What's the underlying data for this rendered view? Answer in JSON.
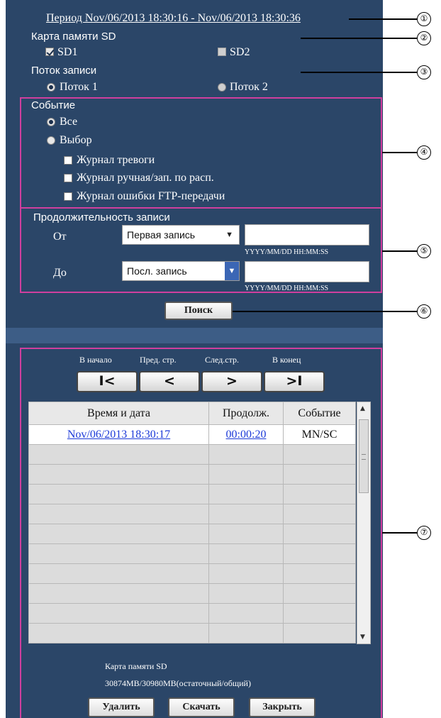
{
  "period": "Период Nov/06/2013 18:30:16 - Nov/06/2013 18:30:36",
  "sd_card": {
    "label": "Карта памяти SD",
    "sd1": "SD1",
    "sd2": "SD2"
  },
  "stream": {
    "label": "Поток записи",
    "stream1": "Поток 1",
    "stream2": "Поток 2"
  },
  "event": {
    "label": "Событие",
    "all": "Все",
    "select": "Выбор",
    "alarm_log": "Журнал тревоги",
    "manual_log": "Журнал ручная/зап. по расп.",
    "ftp_error_log": "Журнал ошибки FTP-передачи"
  },
  "duration": {
    "label": "Продолжительность записи",
    "from_label": "От",
    "to_label": "До",
    "from_value": "Первая запись",
    "to_value": "Посл. запись",
    "format_hint": "YYYY/MM/DD HH:MM:SS"
  },
  "search_button": "Поиск",
  "nav": {
    "first_label": "В начало",
    "prev_label": "Пред. стр.",
    "next_label": "След.стр.",
    "last_label": "В конец",
    "first_glyph": "I<",
    "prev_glyph": "<",
    "next_glyph": ">",
    "last_glyph": ">I"
  },
  "table": {
    "headers": [
      "Время и дата",
      "Продолж.",
      "Событие"
    ],
    "rows": [
      {
        "datetime": "Nov/06/2013  18:30:17",
        "duration": "00:00:20",
        "event": "MN/SC"
      }
    ]
  },
  "footer": {
    "sd_label": "Карта памяти SD",
    "capacity": "30874MB/30980MB(остаточный/общий)",
    "delete": "Удалить",
    "download": "Скачать",
    "close": "Закрыть"
  },
  "callouts": [
    "①",
    "②",
    "③",
    "④",
    "⑤",
    "⑥",
    "⑦"
  ],
  "colors": {
    "panel": "#2b4668",
    "highlight_box": "#cf3f9e",
    "link": "#1c3ad8"
  }
}
